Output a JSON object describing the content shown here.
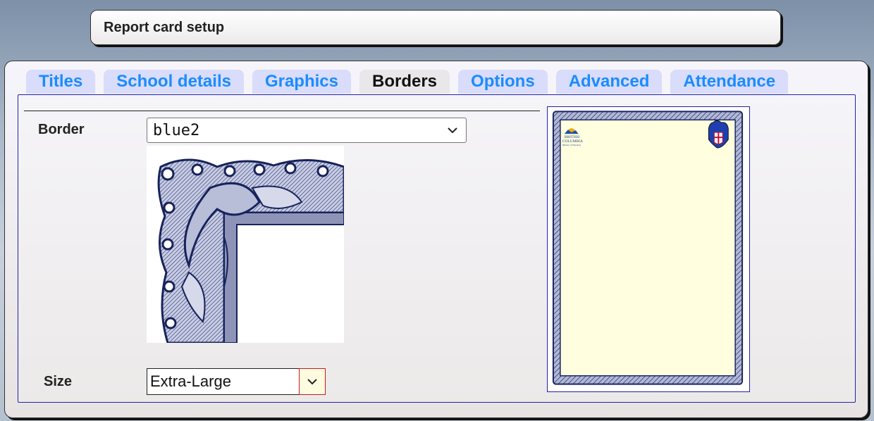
{
  "window": {
    "title": "Report card setup"
  },
  "tabs": [
    {
      "label": "Titles",
      "active": false
    },
    {
      "label": "School details",
      "active": false
    },
    {
      "label": "Graphics",
      "active": false
    },
    {
      "label": "Borders",
      "active": true
    },
    {
      "label": "Options",
      "active": false
    },
    {
      "label": "Advanced",
      "active": false
    },
    {
      "label": "Attendance",
      "active": false
    }
  ],
  "border": {
    "label": "Border",
    "selected": "blue2"
  },
  "size": {
    "label": "Size",
    "selected": "Extra-Large"
  },
  "preview": {
    "logo_text": [
      "BRITISH",
      "COLUMBIA",
      "Ministry of Education"
    ],
    "paper_color": "#fffede",
    "border_color": "#2a3a7a"
  },
  "colors": {
    "tab_text": "#1a8cff",
    "tab_bg": "#d9dcfb",
    "active_tab_text": "#111111"
  }
}
